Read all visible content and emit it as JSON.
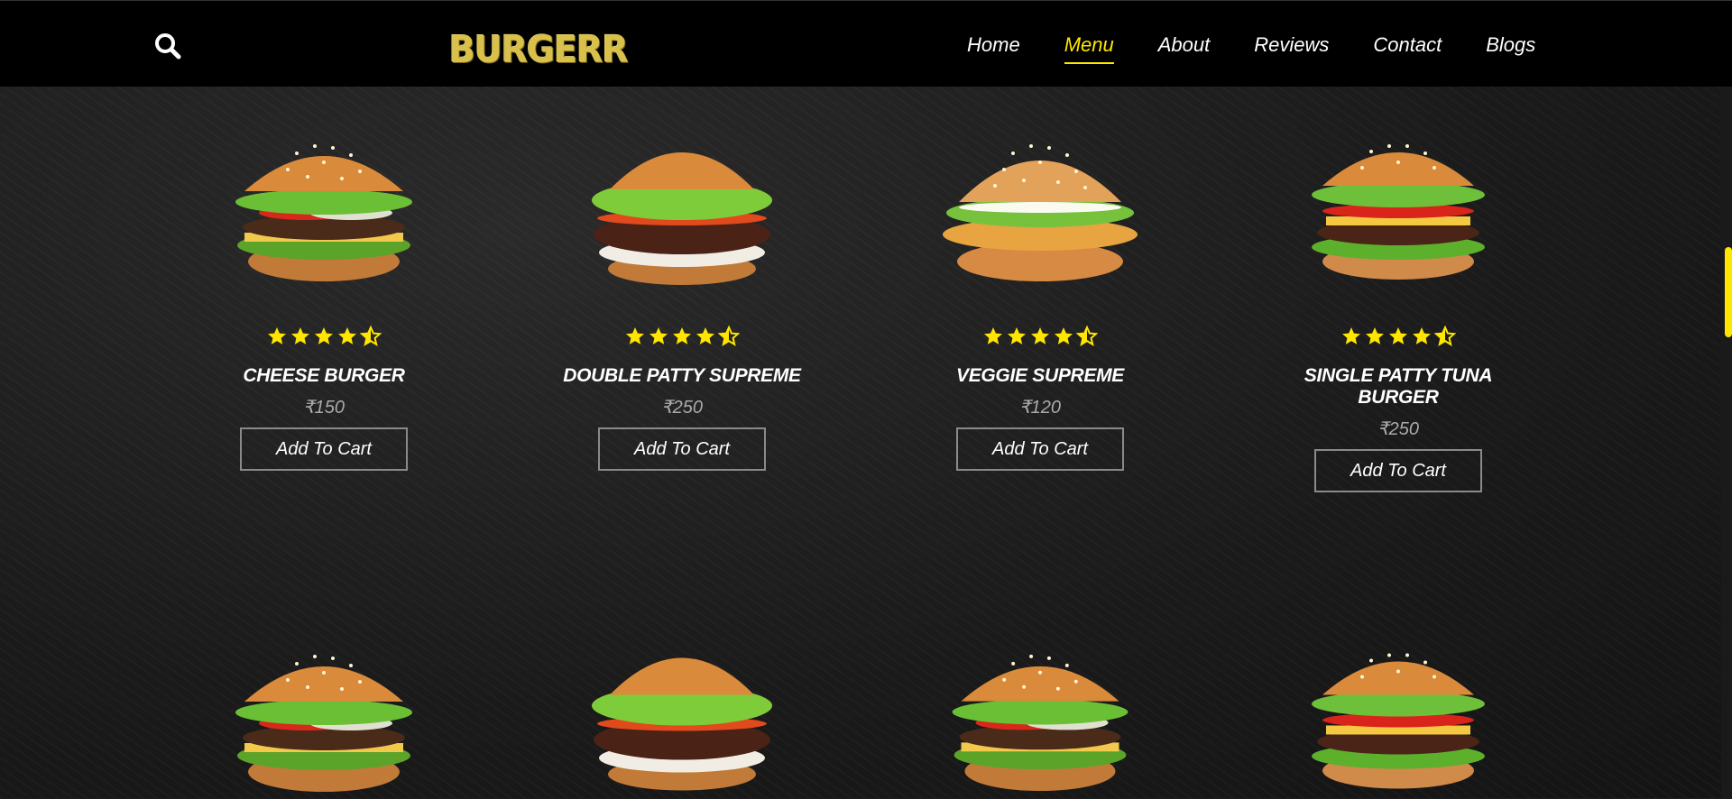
{
  "brand": {
    "logo_text": "BURGERR"
  },
  "nav": {
    "items": [
      "Home",
      "Menu",
      "About",
      "Reviews",
      "Contact",
      "Blogs"
    ],
    "active": "Menu"
  },
  "colors": {
    "accent": "#ffe600",
    "background": "#1c1c1c",
    "header": "#000000"
  },
  "icons": {
    "search": "search-icon",
    "star": "star-icon",
    "half_star": "star-half-icon"
  },
  "menu": {
    "items": [
      {
        "name": "CHEESE BURGER",
        "price": "₹150",
        "rating": 4.5,
        "cta": "Add To Cart"
      },
      {
        "name": "DOUBLE PATTY SUPREME",
        "price": "₹250",
        "rating": 4.5,
        "cta": "Add To Cart"
      },
      {
        "name": "VEGGIE SUPREME",
        "price": "₹120",
        "rating": 4.5,
        "cta": "Add To Cart"
      },
      {
        "name": "SINGLE PATTY TUNA BURGER",
        "price": "₹250",
        "rating": 4.5,
        "cta": "Add To Cart"
      }
    ]
  }
}
